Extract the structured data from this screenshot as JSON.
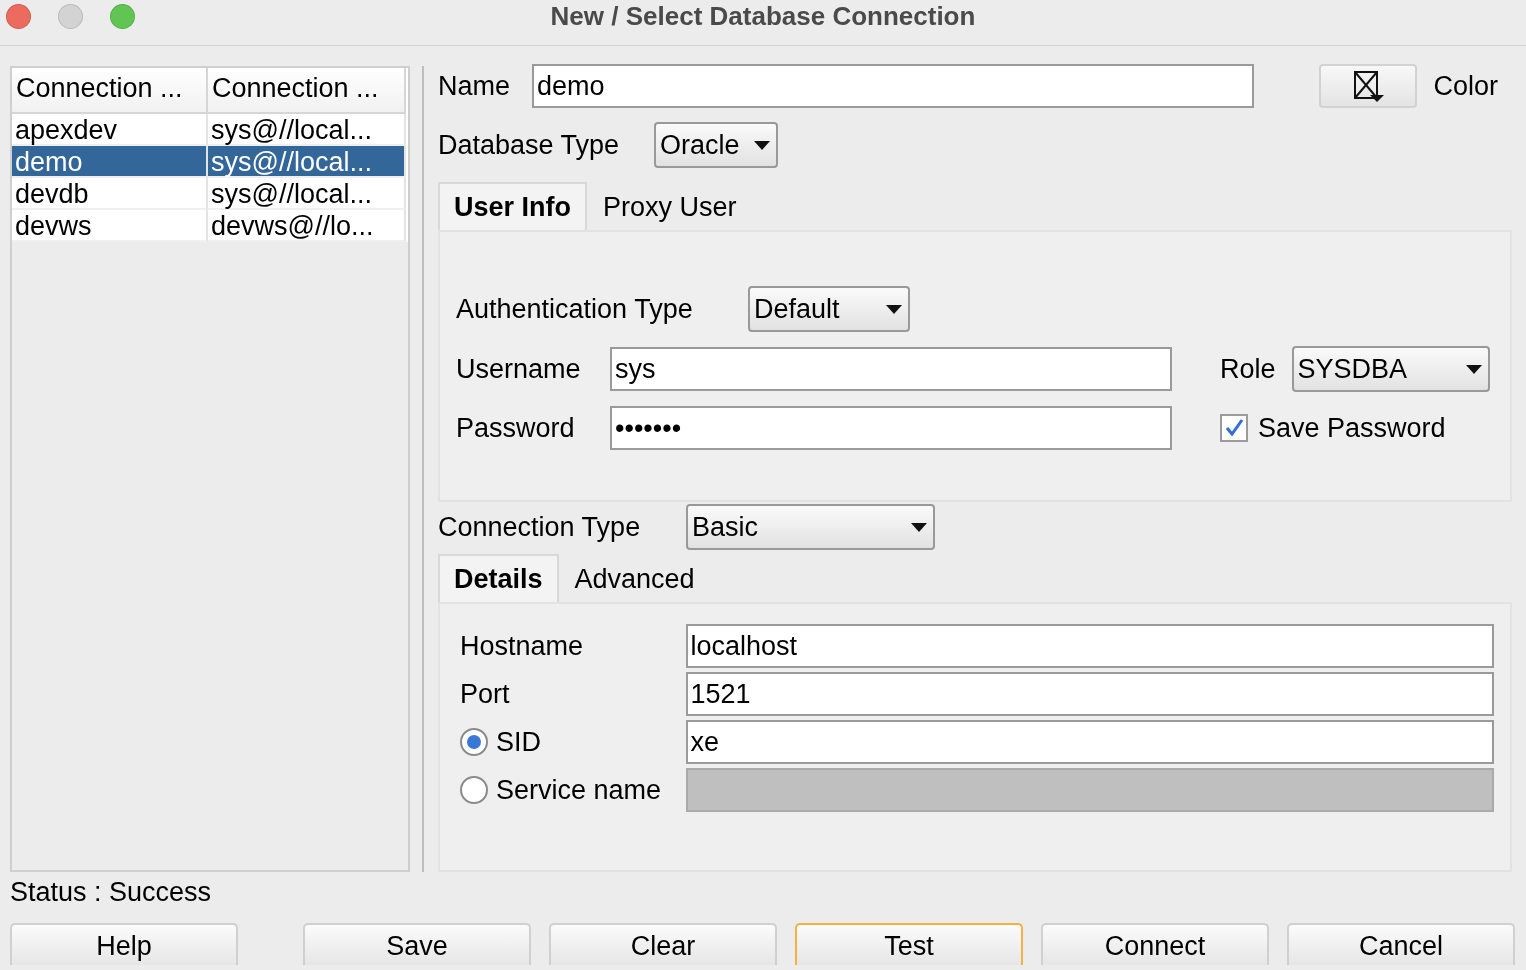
{
  "window": {
    "title": "New / Select Database Connection"
  },
  "connections": {
    "columns": [
      "Connection ...",
      "Connection ..."
    ],
    "rows": [
      {
        "cells": [
          "apexdev",
          "sys@//local..."
        ],
        "selected": false
      },
      {
        "cells": [
          "demo",
          "sys@//local..."
        ],
        "selected": true
      },
      {
        "cells": [
          "devdb",
          "sys@//local..."
        ],
        "selected": false
      },
      {
        "cells": [
          "devws",
          "devws@//lo..."
        ],
        "selected": false
      }
    ]
  },
  "form": {
    "name": {
      "label": "Name",
      "value": "demo"
    },
    "color": {
      "label": "Color"
    },
    "database_type": {
      "label": "Database Type",
      "value": "Oracle"
    },
    "tabs": [
      {
        "label": "User Info",
        "selected": true
      },
      {
        "label": "Proxy User",
        "selected": false
      }
    ],
    "user_info": {
      "authentication_type": {
        "label": "Authentication Type",
        "value": "Default"
      },
      "username": {
        "label": "Username",
        "value": "sys"
      },
      "password": {
        "label": "Password",
        "value": "•••••••"
      },
      "role": {
        "label": "Role",
        "value": "SYSDBA"
      },
      "save_password": {
        "label": "Save Password",
        "checked": true
      }
    },
    "connection_type": {
      "label": "Connection Type",
      "value": "Basic"
    },
    "detail_tabs": [
      {
        "label": "Details",
        "selected": true
      },
      {
        "label": "Advanced",
        "selected": false
      }
    ],
    "details": {
      "hostname": {
        "label": "Hostname",
        "value": "localhost"
      },
      "port": {
        "label": "Port",
        "value": "1521"
      },
      "sid": {
        "label": "SID",
        "selected": true,
        "value": "xe"
      },
      "service_name": {
        "label": "Service name",
        "selected": false,
        "disabled": true
      }
    }
  },
  "status": "Status : Success",
  "buttons": [
    {
      "label": "Help",
      "focused": false
    },
    {
      "label": "Save",
      "focused": false
    },
    {
      "label": "Clear",
      "focused": false
    },
    {
      "label": "Test",
      "focused": true
    },
    {
      "label": "Connect",
      "focused": false
    },
    {
      "label": "Cancel",
      "focused": false
    }
  ]
}
